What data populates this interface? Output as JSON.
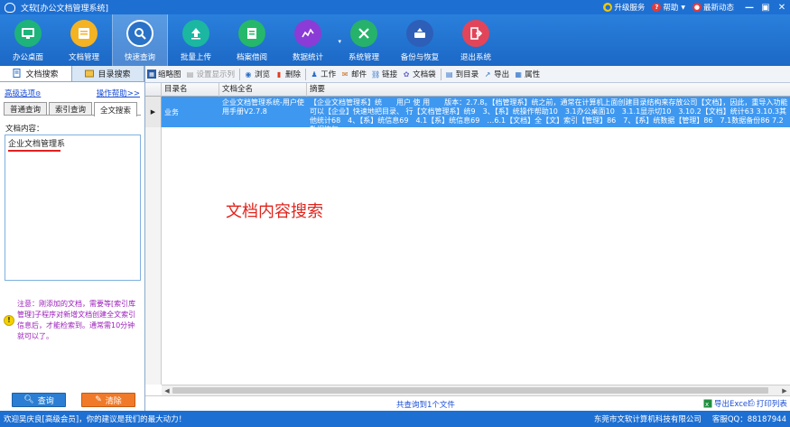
{
  "window": {
    "title": "文软[办公文档管理系统]",
    "links": [
      {
        "label": "升级服务",
        "icon": "person-icon"
      },
      {
        "label": "帮助",
        "icon": "help-icon"
      },
      {
        "label": "最新动态",
        "icon": "news-icon"
      }
    ]
  },
  "toolbar": {
    "items": [
      {
        "label": "办公桌面",
        "icon": "desktop-icon",
        "color": "#1eb37a"
      },
      {
        "label": "文档管理",
        "icon": "folder-icon",
        "color": "#f4b323"
      },
      {
        "label": "快速查询",
        "icon": "search-doc-icon",
        "color": "#2a72c8",
        "active": true
      },
      {
        "label": "批量上传",
        "icon": "upload-icon",
        "color": "#1bb7a1"
      },
      {
        "label": "档案借阅",
        "icon": "borrow-icon",
        "color": "#25b86a"
      },
      {
        "label": "数据统计",
        "icon": "stats-icon",
        "color": "#8b3cd6"
      },
      {
        "label": "系统管理",
        "icon": "tools-icon",
        "color": "#26b26a"
      },
      {
        "label": "备份与恢复",
        "icon": "backup-icon",
        "color": "#2d5fb8"
      },
      {
        "label": "退出系统",
        "icon": "exit-icon",
        "color": "#e2455a"
      }
    ]
  },
  "left": {
    "tabs": [
      {
        "label": "文档搜索",
        "active": true
      },
      {
        "label": "目录搜索",
        "active": false
      }
    ],
    "advanced_link": "高级选项",
    "help_link": "操作帮助>>",
    "search_tabs": [
      "普通查询",
      "索引查询",
      "全文搜索"
    ],
    "active_search_tab": 2,
    "content_label": "文档内容：",
    "content_value": "企业文档管理系",
    "note": "注意：刚添加的文档，需要等[索引库管理]子程序对新增文档创建全文索引信息后，才能检索到。通常需10分钟就可以了。",
    "search_button": "查询",
    "clear_button": "清除"
  },
  "right": {
    "toolbar": [
      {
        "label": "缩略图",
        "icon": "thumbnail-icon",
        "enabled": true
      },
      {
        "label": "设置显示列",
        "icon": "columns-icon",
        "enabled": false
      },
      {
        "label": "浏览",
        "icon": "eye-icon",
        "enabled": true
      },
      {
        "label": "删除",
        "icon": "delete-icon",
        "enabled": true
      },
      {
        "label": "工作",
        "icon": "work-icon",
        "enabled": true
      },
      {
        "label": "邮件",
        "icon": "mail-icon",
        "enabled": true
      },
      {
        "label": "链接",
        "icon": "link-icon",
        "enabled": true
      },
      {
        "label": "文档袋",
        "icon": "bag-icon",
        "enabled": true
      },
      {
        "label": "到目录",
        "icon": "goto-dir-icon",
        "enabled": true
      },
      {
        "label": "导出",
        "icon": "export-icon",
        "enabled": true
      },
      {
        "label": "属性",
        "icon": "props-icon",
        "enabled": true
      }
    ],
    "columns": [
      "目录名",
      "文档全名",
      "摘要"
    ],
    "rows": [
      {
        "dir": "业务",
        "fullname": "企业文档管理系统-用户使用手册V2.7.8",
        "summary": "【企业文档管理系】统　　用户 使 用　　版本：2.7.8。【档管理系】统之前，通常在计算机上面创建目录结构来存放公司【文档】，因此，重导入功能可以【企业】快速地把目录、 行【文档管理系】统9　3、【系】统操作帮助10　3.1办公桌面10　3.1.1显示切10　3.10.2【文档】统计63 3.10.3其他统计68　4、【系】统信息69　4.1【系】统信息69　…6.1【文档】全【文】索引【管理】86　7、【系】统数据【管理】86　7.1数据备份86 7.2数据恢复"
      }
    ],
    "watermark": "文档内容搜索",
    "found_text": "共查询到1个文件",
    "export_excel": "导出Excel",
    "print_list": "打印列表"
  },
  "statusbar": {
    "welcome": "欢迎吴庆良[高级会员]，你的建议是我们的最大动力！",
    "company": "东莞市文软计算机科技有限公司",
    "qq": "客服QQ：88187944"
  }
}
